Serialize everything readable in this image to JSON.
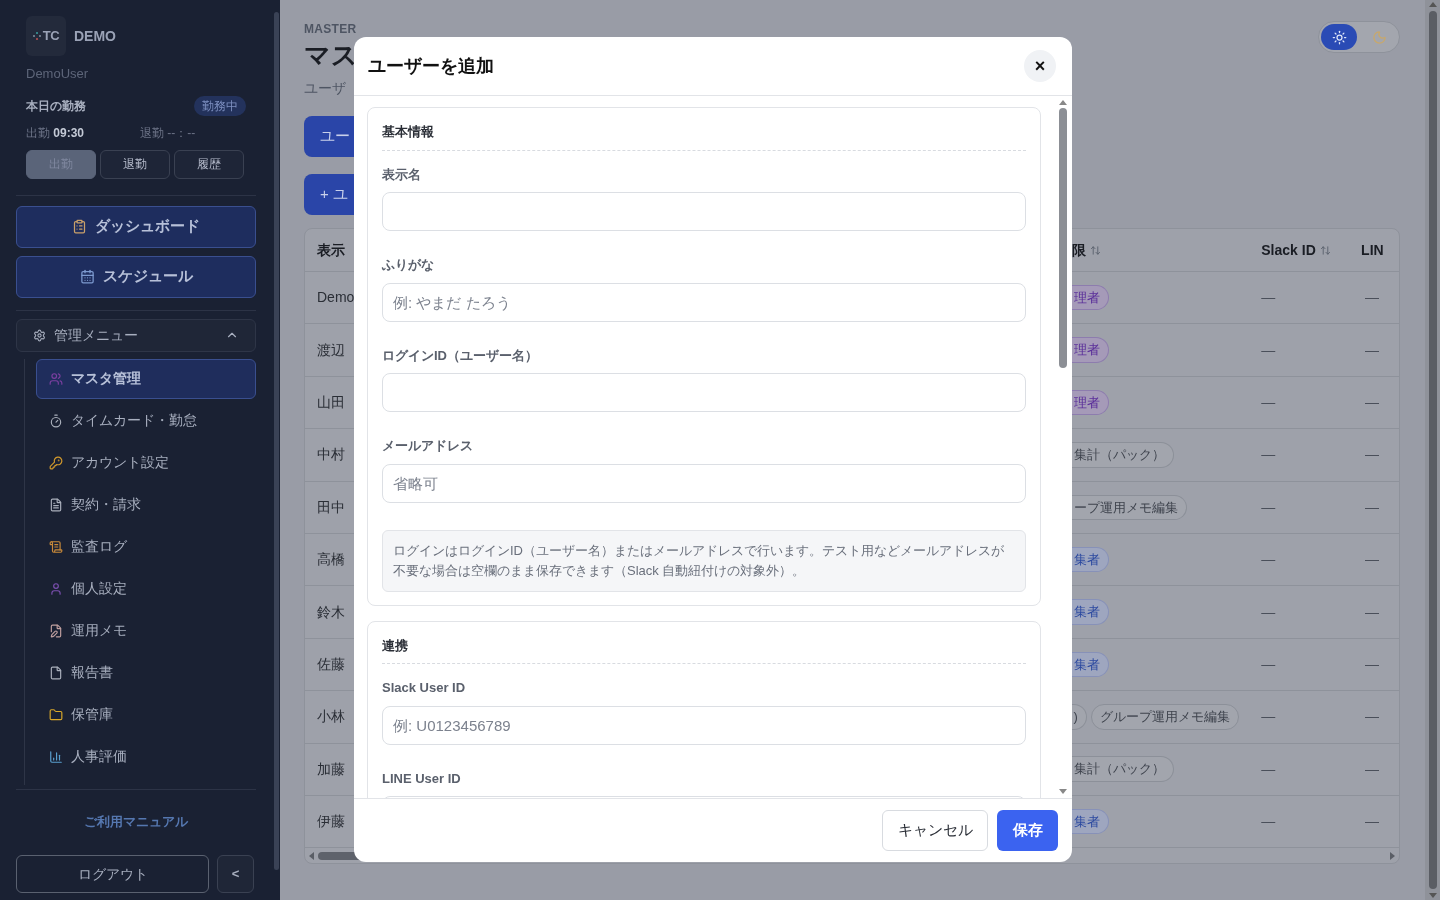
{
  "sidebar": {
    "logo": "TC",
    "brand": "DEMO",
    "user": "DemoUser",
    "attendance": {
      "title": "本日の勤務",
      "status": "勤務中",
      "clock_in": "出勤 **09:30**",
      "clock_out": "退勤 --：--",
      "buttons": [
        {
          "label": "出勤",
          "disabled": true
        },
        {
          "label": "退勤",
          "disabled": false
        },
        {
          "label": "履歴",
          "disabled": false
        }
      ]
    },
    "primary_nav": [
      "ダッシュボード",
      "スケジュール"
    ],
    "admin_menu": {
      "label": "管理メニュー",
      "expanded": true,
      "items": [
        {
          "label": "マスタ管理",
          "selected": true
        },
        {
          "label": "タイムカード・勤怠",
          "selected": false
        },
        {
          "label": "アカウント設定",
          "selected": false
        },
        {
          "label": "契約・請求",
          "selected": false
        },
        {
          "label": "監査ログ",
          "selected": false
        },
        {
          "label": "個人設定",
          "selected": false
        },
        {
          "label": "運用メモ",
          "selected": false
        },
        {
          "label": "報告書",
          "selected": false
        },
        {
          "label": "保管庫",
          "selected": false
        },
        {
          "label": "人事評価",
          "selected": false
        }
      ]
    },
    "manual_link": "ご利用マニュアル",
    "logout": "ログアウト",
    "collapse": "<"
  },
  "page": {
    "eyebrow": "MASTER",
    "title": "マス",
    "subtitle": "ユーザ",
    "tab_button": "ユー",
    "add_button": "+ ユ",
    "theme_toggle": [
      {
        "kind": "light",
        "selected": true
      },
      {
        "kind": "dark",
        "selected": false
      }
    ],
    "table": {
      "columns": [
        "表示",
        "限",
        "Slack ID",
        "LIN"
      ],
      "rows": [
        {
          "name": "Demo",
          "roles": [
            {
              "text": "理者",
              "kind": "purple"
            }
          ],
          "slack": "—",
          "line": "—"
        },
        {
          "name": "渡辺",
          "roles": [
            {
              "text": "理者",
              "kind": "purple"
            }
          ],
          "slack": "—",
          "line": "—"
        },
        {
          "name": "山田",
          "roles": [
            {
              "text": "理者",
              "kind": "purple"
            }
          ],
          "slack": "—",
          "line": "—"
        },
        {
          "name": "中村",
          "roles": [
            {
              "text": "集計（パック）",
              "kind": "gray"
            }
          ],
          "slack": "—",
          "line": "—"
        },
        {
          "name": "田中",
          "roles": [
            {
              "text": "ープ運用メモ編集",
              "kind": "gray"
            }
          ],
          "slack": "—",
          "line": "—"
        },
        {
          "name": "高橋",
          "roles": [
            {
              "text": "集者",
              "kind": "blue"
            }
          ],
          "slack": "—",
          "line": "—"
        },
        {
          "name": "鈴木",
          "roles": [
            {
              "text": "集者",
              "kind": "blue"
            }
          ],
          "slack": "—",
          "line": "—"
        },
        {
          "name": "佐藤",
          "roles": [
            {
              "text": "集者",
              "kind": "blue"
            }
          ],
          "slack": "—",
          "line": "—"
        },
        {
          "name": "小林",
          "roles": [
            {
              "text": ")",
              "kind": "gray"
            },
            {
              "text": "グループ運用メモ編集",
              "kind": "gray"
            }
          ],
          "slack": "—",
          "line": "—"
        },
        {
          "name": "加藤",
          "roles": [
            {
              "text": "集計（パック）",
              "kind": "gray"
            }
          ],
          "slack": "—",
          "line": "—"
        },
        {
          "name": "伊藤",
          "roles": [
            {
              "text": "集者",
              "kind": "blue"
            }
          ],
          "slack": "—",
          "line": "—"
        }
      ]
    }
  },
  "dialog": {
    "title": "ユーザーを追加",
    "close": "×",
    "sections": [
      {
        "heading": "基本情報",
        "fields": [
          {
            "label": "表示名"
          },
          {
            "label": "ふりがな",
            "placeholder": "例: やまだ たろう"
          },
          {
            "label": "ログインID（ユーザー名）"
          },
          {
            "label": "メールアドレス",
            "placeholder": "省略可"
          }
        ],
        "note": "ログインはログインID（ユーザー名）またはメールアドレスで行います。テスト用などメールアドレスが不要な場合は空欄のまま保存できます（Slack 自動紐付けの対象外）。"
      },
      {
        "heading": "連携",
        "fields": [
          {
            "label": "Slack User ID",
            "placeholder": "例: U0123456789"
          },
          {
            "label": "LINE User ID"
          }
        ]
      }
    ],
    "cancel": "キャンセル",
    "save": "保存"
  }
}
